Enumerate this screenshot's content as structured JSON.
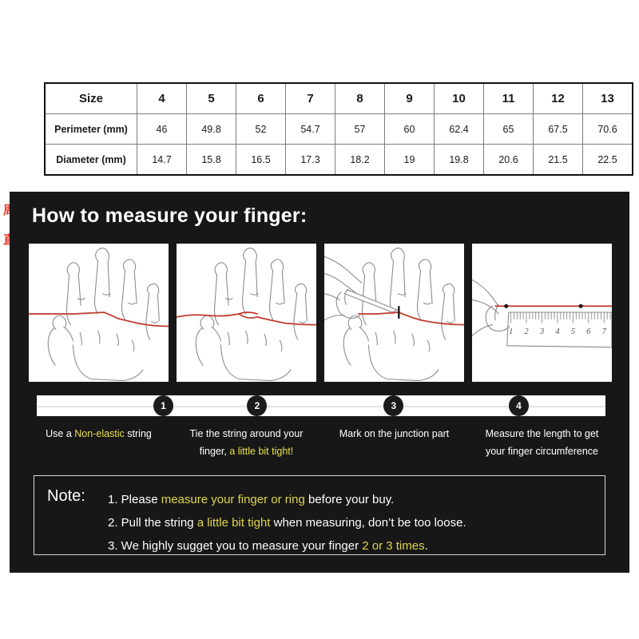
{
  "size_table": {
    "row_labels": [
      "Size",
      "Perimeter (mm)",
      "Diameter (mm)"
    ],
    "sizes": [
      "4",
      "5",
      "6",
      "7",
      "8",
      "9",
      "10",
      "11",
      "12",
      "13"
    ],
    "perimeter_mm": [
      "46",
      "49.8",
      "52",
      "54.7",
      "57",
      "60",
      "62.4",
      "65",
      "67.5",
      "70.6"
    ],
    "diameter_mm": [
      "14.7",
      "15.8",
      "16.5",
      "17.3",
      "18.2",
      "19",
      "19.8",
      "20.6",
      "21.5",
      "22.5"
    ],
    "cn_labels": {
      "perimeter": "周长",
      "diameter": "直径"
    },
    "label_color": "#e8392b"
  },
  "howto": {
    "title": "How to measure your finger:",
    "panels": [
      {
        "name": "hand-with-string-panel",
        "ruler_ticks": []
      },
      {
        "name": "hand-string-tied-panel",
        "ruler_ticks": []
      },
      {
        "name": "hand-marking-panel",
        "ruler_ticks": []
      },
      {
        "name": "ruler-measure-panel",
        "ruler_ticks": [
          "1",
          "2",
          "3",
          "4",
          "5",
          "6",
          "7"
        ]
      }
    ],
    "steps": [
      {
        "number": "1",
        "pos_pct": 22,
        "segments": [
          {
            "text": "Use a ",
            "hl": false
          },
          {
            "text": "Non-elastic",
            "hl": true
          },
          {
            "text": " string",
            "hl": false
          }
        ]
      },
      {
        "number": "2",
        "pos_pct": 38,
        "segments": [
          {
            "text": "Tie the string around your finger, ",
            "hl": false
          },
          {
            "text": "a little bit tight!",
            "hl": true
          }
        ]
      },
      {
        "number": "3",
        "pos_pct": 62,
        "segments": [
          {
            "text": "Mark on the junction part",
            "hl": false
          }
        ]
      },
      {
        "number": "4",
        "pos_pct": 83,
        "segments": [
          {
            "text": "Measure the length to get your finger circumference",
            "hl": false
          }
        ]
      }
    ]
  },
  "note": {
    "label": "Note:",
    "lines": [
      [
        {
          "text": "1. Please ",
          "hl": false
        },
        {
          "text": "measure your finger or ring",
          "hl": true
        },
        {
          "text": " before your buy.",
          "hl": false
        }
      ],
      [
        {
          "text": "2. Pull the string ",
          "hl": false
        },
        {
          "text": "a little bit tight",
          "hl": true
        },
        {
          "text": " when measuring, don’t be too loose.",
          "hl": false
        }
      ],
      [
        {
          "text": "3. We highly sugget you to measure your finger ",
          "hl": false
        },
        {
          "text": "2 or 3 times",
          "hl": true
        },
        {
          "text": ".",
          "hl": false
        }
      ]
    ],
    "highlight_color": "#ded54a"
  }
}
